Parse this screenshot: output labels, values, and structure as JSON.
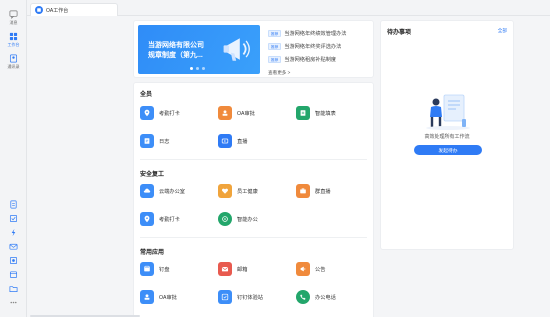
{
  "sidebar": {
    "items": [
      {
        "label": "消息",
        "icon": "message-icon"
      },
      {
        "label": "工作台",
        "icon": "workbench-icon",
        "active": true
      },
      {
        "label": "通讯录",
        "icon": "contacts-icon"
      }
    ],
    "bottom_icons": [
      "document-icon",
      "checklist-icon",
      "lightning-icon",
      "mail-icon",
      "phone-icon",
      "calendar-icon",
      "folder-icon",
      "more-icon"
    ]
  },
  "tabs": [
    {
      "label": "OA工作台",
      "icon": "oa-icon",
      "active": true
    }
  ],
  "banner": {
    "line1": "当游网络有限公司",
    "line2": "规章制度（第九..."
  },
  "news": {
    "items": [
      {
        "tag": "推荐",
        "text": "当游网络年终绩效管理办法"
      },
      {
        "tag": "推荐",
        "text": "当游网络年终奖评选办法"
      },
      {
        "tag": "推荐",
        "text": "当游网络租房补贴制度"
      }
    ],
    "more_label": "查看更多 >"
  },
  "sections": [
    {
      "title": "全员",
      "apps": [
        {
          "name": "考勤打卡",
          "color": "#3d8ef8",
          "icon": "location-icon"
        },
        {
          "name": "OA审批",
          "color": "#f08a3c",
          "icon": "approval-icon"
        },
        {
          "name": "智能填表",
          "color": "#23a66b",
          "icon": "form-icon"
        },
        {
          "name": "日志",
          "color": "#3d8ef8",
          "icon": "log-icon"
        },
        {
          "name": "直播",
          "color": "#2f7bf5",
          "icon": "live-icon"
        }
      ]
    },
    {
      "title": "安全复工",
      "apps": [
        {
          "name": "云端办公室",
          "color": "#3d8ef8",
          "icon": "cloud-office-icon"
        },
        {
          "name": "员工健康",
          "color": "#f0a43c",
          "icon": "health-icon"
        },
        {
          "name": "群直播",
          "color": "#f08a3c",
          "icon": "group-live-icon"
        },
        {
          "name": "考勤打卡",
          "color": "#3d8ef8",
          "icon": "location-icon"
        },
        {
          "name": "智能办公",
          "color": "#23a66b",
          "icon": "smart-office-icon"
        }
      ]
    },
    {
      "title": "常用应用",
      "apps": [
        {
          "name": "钉盘",
          "color": "#3d8ef8",
          "icon": "disk-icon"
        },
        {
          "name": "邮箱",
          "color": "#e85a4f",
          "icon": "mail-icon"
        },
        {
          "name": "公告",
          "color": "#f08a3c",
          "icon": "announcement-icon"
        },
        {
          "name": "OA审批",
          "color": "#3d8ef8",
          "icon": "approval-icon"
        },
        {
          "name": "钉钉体验站",
          "color": "#3d8ef8",
          "icon": "experience-icon"
        },
        {
          "name": "办公电话",
          "color": "#23a66b",
          "icon": "phone-icon"
        }
      ]
    }
  ],
  "todo": {
    "title": "待办事项",
    "all_label": "全部",
    "description": "高效处理所有工作流",
    "button_label": "发起待办"
  }
}
